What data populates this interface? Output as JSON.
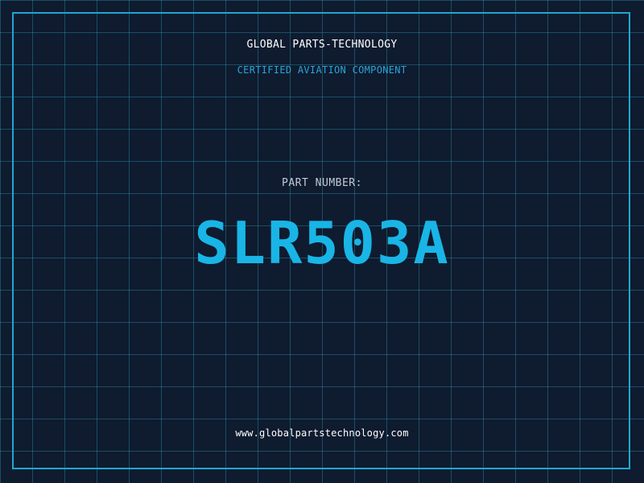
{
  "header": {
    "company": "GLOBAL PARTS-TECHNOLOGY",
    "tagline": "CERTIFIED AVIATION COMPONENT"
  },
  "part": {
    "label": "PART NUMBER:",
    "number": "SLR503A"
  },
  "footer": {
    "website": "www.globalpartstechnology.com"
  },
  "colors": {
    "background": "#0f1b2f",
    "grid": "#2896af",
    "frame": "#1ea8cf",
    "accent": "#19b5e6",
    "tagline": "#2aa6d8",
    "label": "#c3cad6",
    "text": "#ffffff"
  }
}
